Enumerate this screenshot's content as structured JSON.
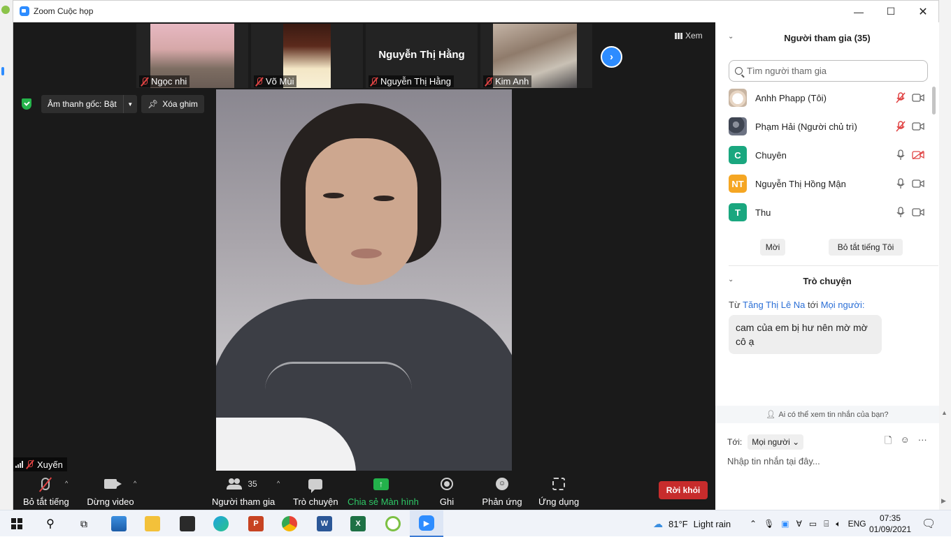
{
  "window": {
    "title": "Zoom Cuộc họp"
  },
  "gallery": {
    "thumbnails": [
      {
        "name": "Ngọc nhi",
        "has_video": true
      },
      {
        "name": "Võ Mùi",
        "has_video": true
      },
      {
        "name": "Nguyễn Thị Hằng",
        "has_video": false,
        "center_name": "Nguyễn Thị Hằng"
      },
      {
        "name": "Kim Anh",
        "has_video": true
      }
    ],
    "view_label": "Xem"
  },
  "controls": {
    "original_audio": "Âm thanh gốc: Bật",
    "unpin": "Xóa ghim"
  },
  "main_video": {
    "name": "Xuyến"
  },
  "toolbar": {
    "mute": "Bỏ tắt tiếng",
    "video": "Dừng video",
    "participants": "Người tham gia",
    "participants_count": "35",
    "chat": "Trò chuyện",
    "share": "Chia sẻ Màn hình",
    "record": "Ghi",
    "reactions": "Phản ứng",
    "apps": "Ứng dụng",
    "leave": "Rời khỏi"
  },
  "participants_panel": {
    "title": "Người tham gia (35)",
    "search_placeholder": "Tìm người tham gia",
    "list": [
      {
        "name": "Anhh Phapp (Tôi)",
        "avatar_text": "",
        "avatar_color": "#e8e1d8",
        "mic": "muted",
        "video": "on"
      },
      {
        "name": "Phạm Hải (Người chủ trì)",
        "avatar_text": "",
        "avatar_color": "#5a6170",
        "mic": "muted",
        "video": "on"
      },
      {
        "name": "Chuyên",
        "avatar_text": "C",
        "avatar_color": "#1aa77f",
        "mic": "on",
        "video": "off"
      },
      {
        "name": "Nguyễn Thị Hồng Mận",
        "avatar_text": "NT",
        "avatar_color": "#f5a623",
        "mic": "on",
        "video": "on"
      },
      {
        "name": "Thu",
        "avatar_text": "T",
        "avatar_color": "#1aa77f",
        "mic": "on",
        "video": "on"
      }
    ],
    "invite": "Mời",
    "unmute_me": "Bỏ tắt tiếng Tôi"
  },
  "chat_panel": {
    "title": "Trò chuyện",
    "from_prefix": "Từ",
    "from_name": "Tăng Thị Lê Na",
    "to_word": "tới",
    "to_name": "Mọi người:",
    "message": "cam của em bị hư nên mờ mờ cô ạ",
    "privacy": "Ai có thể xem tin nhắn của bạn?",
    "to_label": "Tới:",
    "recipient": "Mọi người",
    "input_placeholder": "Nhập tin nhắn tại đây..."
  },
  "taskbar": {
    "weather_temp": "81°F",
    "weather_text": "Light rain",
    "time": "07:35",
    "date": "01/09/2021"
  }
}
